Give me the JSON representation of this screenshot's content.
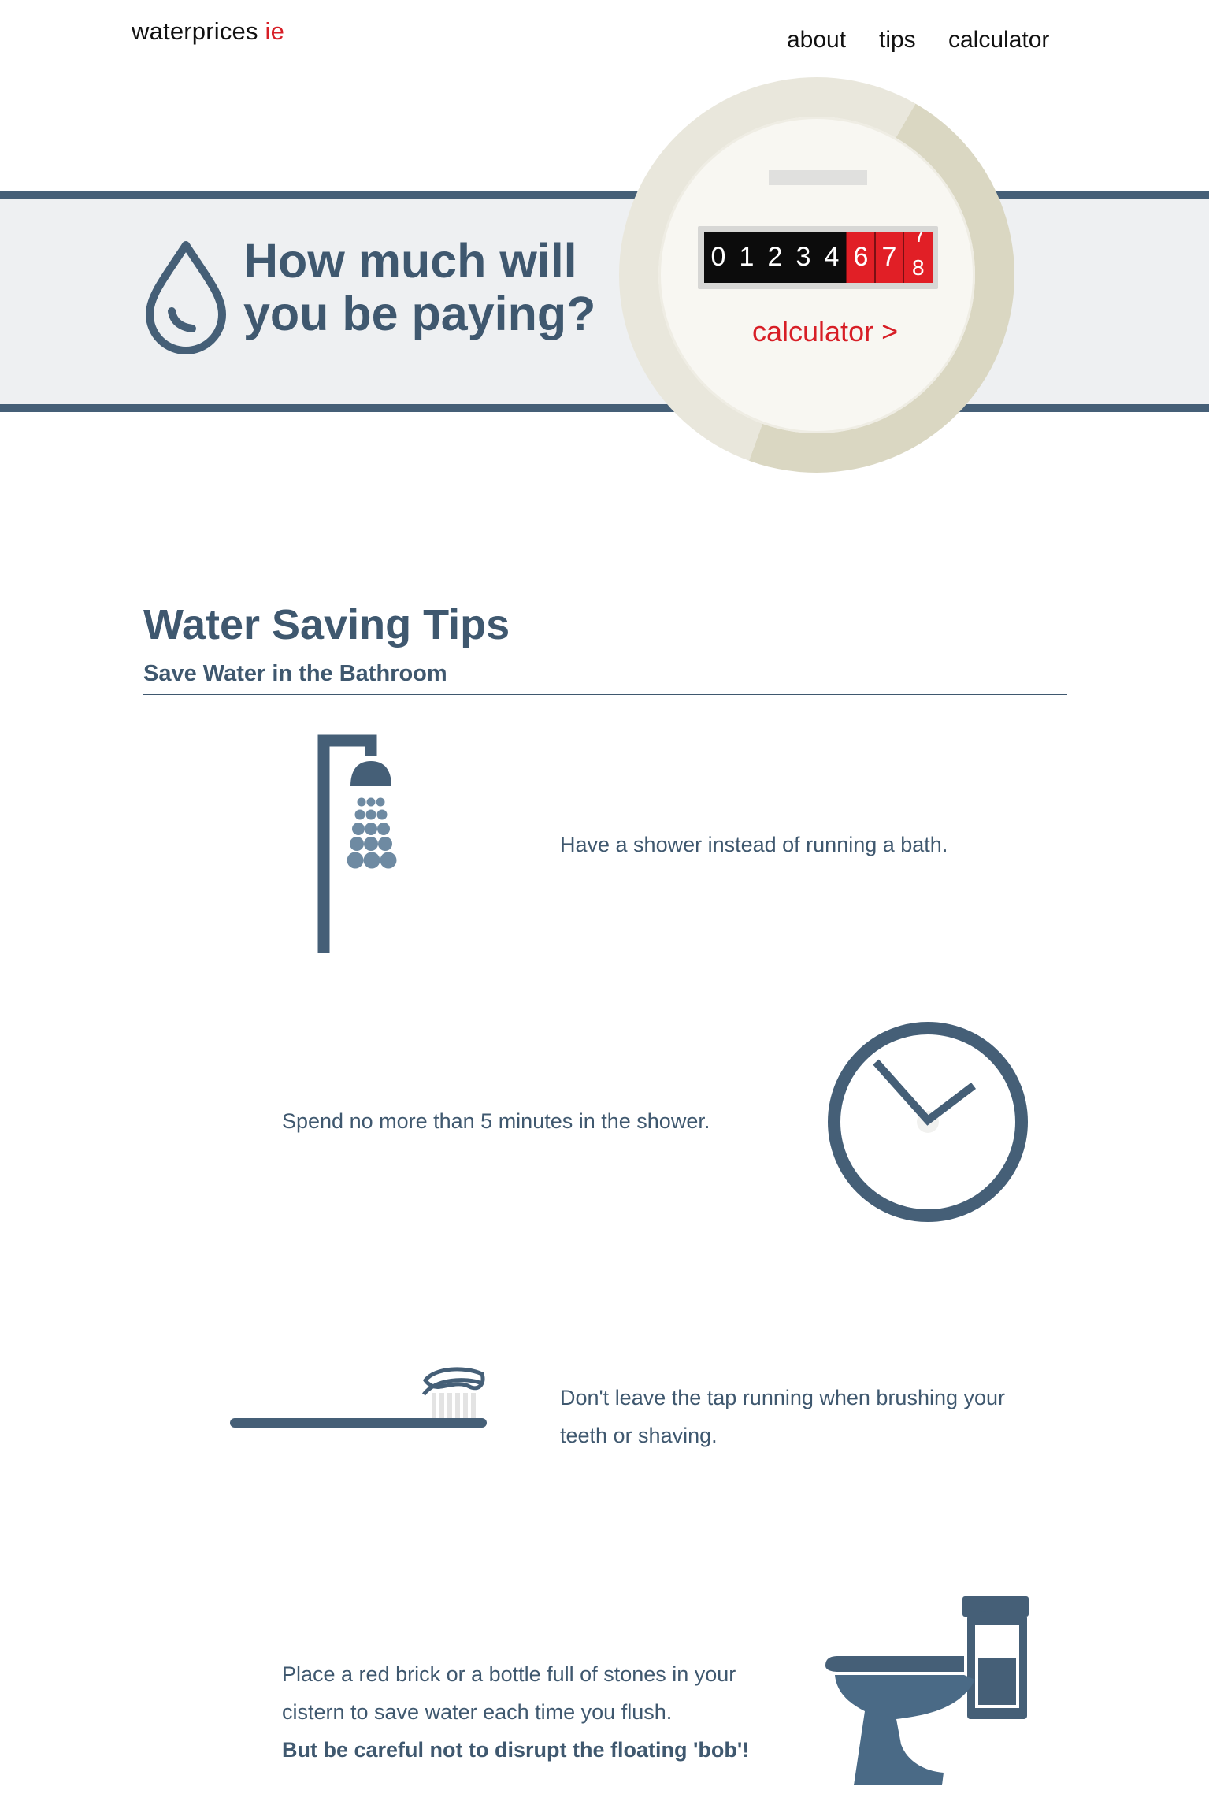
{
  "header": {
    "logo_main": "waterprices",
    "logo_accent": "ie",
    "nav": [
      {
        "label": "about"
      },
      {
        "label": "tips"
      },
      {
        "label": "calculator"
      }
    ]
  },
  "hero": {
    "title_line1": "How much will",
    "title_line2": "you be paying?",
    "meter_digits": [
      "0",
      "1",
      "2",
      "3",
      "4",
      "6",
      "7"
    ],
    "meter_roll_top": "7",
    "meter_roll_bottom": "8",
    "calculator_link": "calculator >"
  },
  "tips": {
    "title": "Water Saving Tips",
    "subtitle": "Save Water in the Bathroom",
    "items": [
      {
        "text": "Have a shower instead of running a bath.",
        "icon": "shower-icon"
      },
      {
        "text": "Spend no more than 5 minutes in the shower.",
        "icon": "clock-icon"
      },
      {
        "text": "Don't leave the tap running when brushing your teeth or shaving.",
        "icon": "toothbrush-icon"
      },
      {
        "text": "Place a red brick or a bottle full of stones in your cistern to save water each time you flush.",
        "emphasis": "But be careful not to disrupt the floating 'bob'!",
        "icon": "toilet-icon"
      }
    ]
  },
  "colors": {
    "primary": "#3f586f",
    "accent": "#d71e26",
    "band": "#eef0f2",
    "meter_ring": "#dad7c2"
  }
}
